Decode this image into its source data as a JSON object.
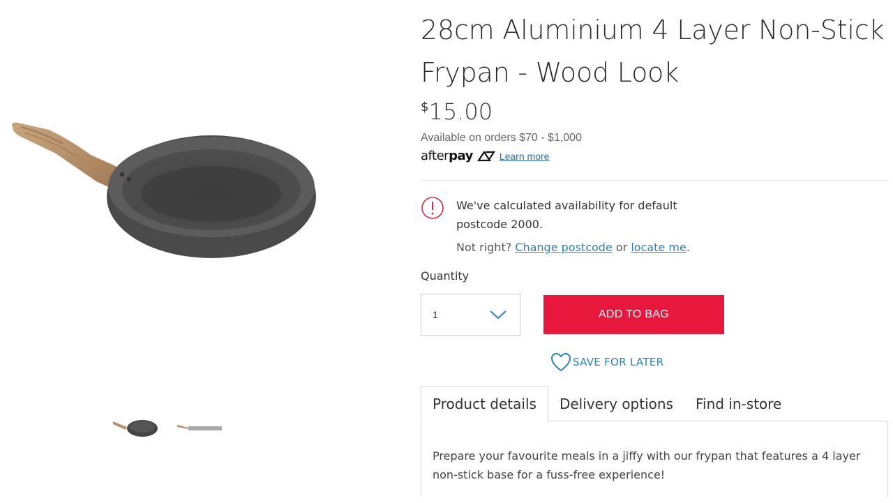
{
  "product": {
    "title": "28cm Aluminium 4 Layer Non-Stick Frypan - Wood Look",
    "price_currency": "$",
    "price_amount": "15.00"
  },
  "afterpay": {
    "availability": "Available on orders $70 - $1,000",
    "logo_prefix": "after",
    "logo_bold": "pay",
    "learn_more": "Learn more"
  },
  "availability_notice": {
    "message": "We've calculated availability for default postcode 2000.",
    "prompt": "Not right?",
    "change_link": "Change postcode",
    "or_text": "or",
    "locate_link": "locate me",
    "end_punct": "."
  },
  "purchase": {
    "quantity_label": "Quantity",
    "quantity_value": "1",
    "add_button": "ADD TO BAG",
    "save_later": "SAVE FOR LATER"
  },
  "tabs": [
    {
      "label": "Product details",
      "active": true
    },
    {
      "label": "Delivery options",
      "active": false
    },
    {
      "label": "Find in-store",
      "active": false
    }
  ],
  "details_text": "Prepare your favourite meals in a jiffy with our frypan that features a 4 layer non-stick base for a fuss-free experience!",
  "colors": {
    "accent_red": "#e8173c",
    "link_blue": "#2b82b4",
    "alert_red": "#d6283f"
  },
  "icons": {
    "alert": "alert-circle-icon",
    "chevron": "chevron-down-icon",
    "heart": "heart-icon"
  }
}
